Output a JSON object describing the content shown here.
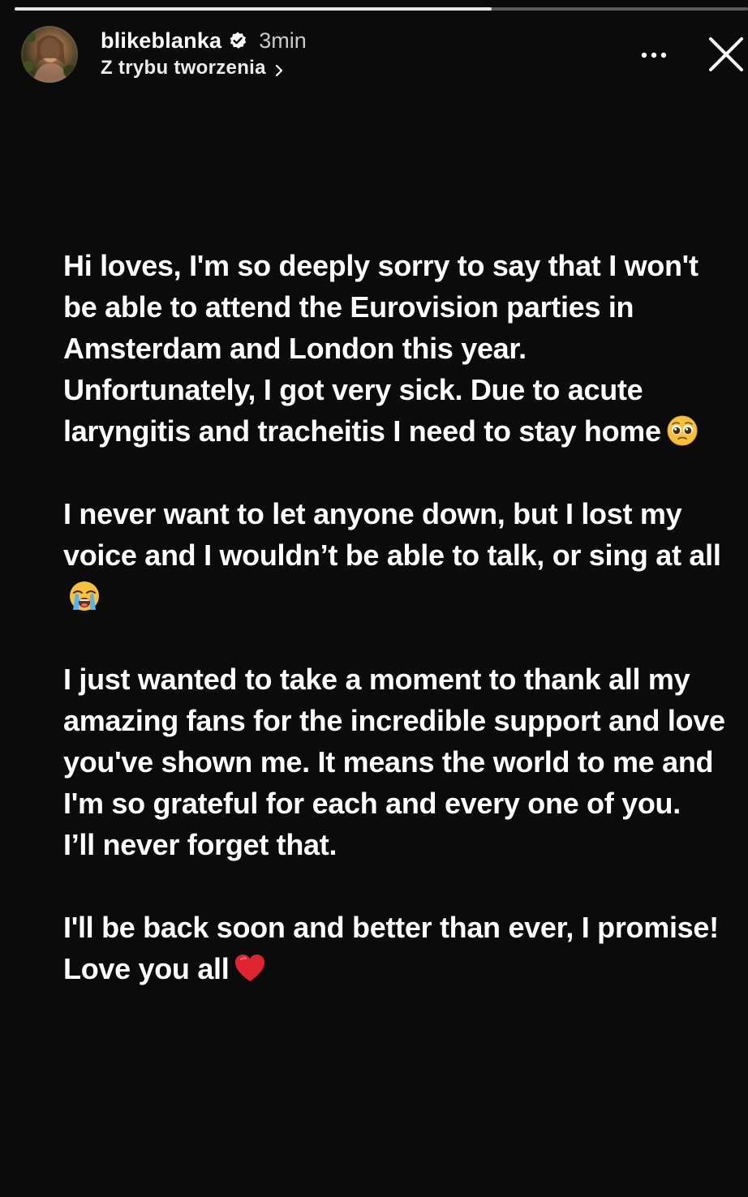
{
  "story": {
    "progress": 0.65,
    "user": {
      "username": "blikeblanka",
      "verified": true,
      "posted_ago": "3min",
      "subtitle": "Z trybu tworzenia",
      "avatar_icon": "avatar"
    },
    "controls": {
      "more_icon": "more-options-icon",
      "close_icon": "close-icon"
    },
    "text": {
      "p1_line1": "Hi loves, I'm so deeply sorry to say that I won't be able to attend the Eurovision parties in Amsterdam and London this year.",
      "p1_line2": "Unfortunately, I got very sick. Due to acute laryngitis and tracheitis I need to stay home",
      "p1_emoji": "pleading-face-emoji",
      "p2": "I never want to let anyone down, but I lost my voice and I wouldn’t be able to talk, or sing at all",
      "p2_emoji": "loudly-crying-face-emoji",
      "p3_line1": "I just wanted to take a moment to thank all my amazing fans for the incredible support and love you've shown me. It means the world to me and I'm so grateful for each and every one of you.",
      "p3_line2": "I’ll never forget that.",
      "p4": "I'll be back soon and better than ever, I promise! Love you all",
      "p4_emoji": "red-heart-emoji"
    },
    "colors": {
      "background": "#0b0b0b",
      "text": "#ffffff",
      "heart": "#e0242f",
      "emoji_yellow": "#f7c23a"
    }
  }
}
